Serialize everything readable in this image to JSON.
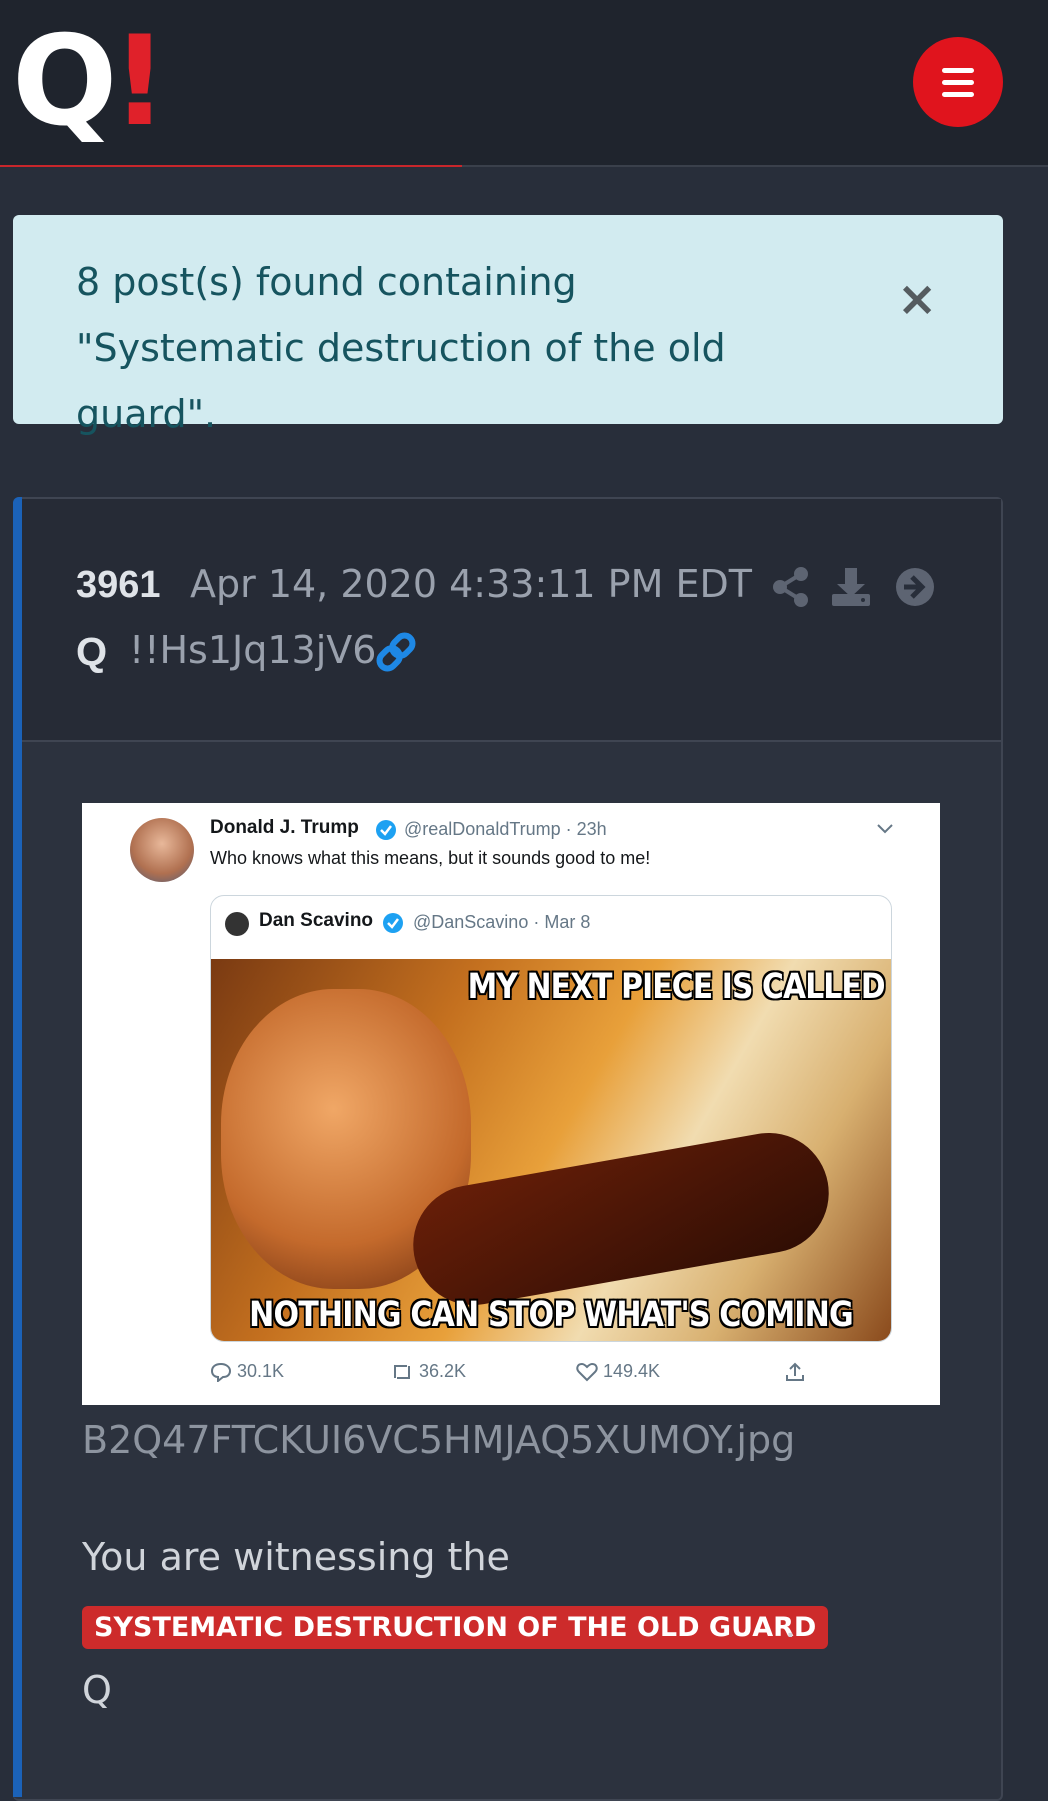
{
  "header": {
    "logo_q": "Q",
    "logo_bang": "!",
    "menu_icon": "hamburger-menu-icon",
    "accent_color": "#e0141d"
  },
  "alert": {
    "text": "8 post(s) found containing \"Systematic destruction of the old guard\".",
    "close_label": "×",
    "background": "#d2ebf0"
  },
  "post": {
    "number": "3961",
    "date": "Apr 14, 2020 4:33:11 PM EDT",
    "author": "Q",
    "tripcode": "!!Hs1Jq13jV6",
    "actions": [
      "share-icon",
      "download-icon",
      "arrow-right-circle-icon",
      "link-icon"
    ],
    "image": {
      "tweet_name": "Donald J. Trump",
      "tweet_handle": "@realDonaldTrump · 23h",
      "tweet_text": "Who knows what this means, but it sounds good to me!",
      "quote_name": "Dan Scavino",
      "quote_handle": "@DanScavino · Mar 8",
      "meme_top": "MY NEXT PIECE IS CALLED",
      "meme_bottom": "NOTHING CAN STOP WHAT'S COMING",
      "replies": "30.1K",
      "retweets": "36.2K",
      "likes": "149.4K"
    },
    "filename": "B2Q47FTCKUI6VC5HMJAQ5XUMOY.jpg",
    "body_line1": "You are witnessing the",
    "highlight": "SYSTEMATIC DESTRUCTION OF THE OLD GUARD",
    "period": ".",
    "signature": "Q",
    "accent_color": "#1b62b8",
    "highlight_color": "#cd2b2b"
  }
}
